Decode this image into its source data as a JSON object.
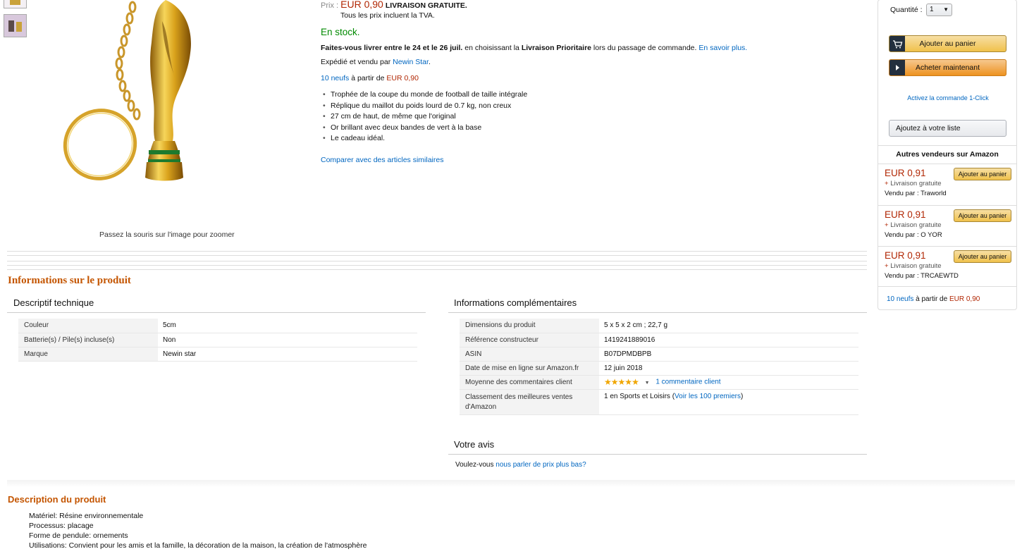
{
  "gallery": {
    "zoom_hint": "Passez la souris sur l'image pour zoomer"
  },
  "offer": {
    "price_label": "Prix :",
    "price": "EUR 0,90",
    "free_shipping": "LIVRAISON GRATUITE.",
    "tva_note": "Tous les prix incluent la TVA.",
    "availability": "En stock.",
    "delivery_prefix": "Faites-vous livrer entre le 24 et le 26 juil.",
    "delivery_mid": " en choisissant la ",
    "delivery_option": "Livraison Prioritaire",
    "delivery_suffix": " lors du passage de commande. ",
    "learn_more": "En savoir plus.",
    "shipped_prefix": "Expédié et vendu par ",
    "seller": "Newin Star",
    "new_count_link": "10 neufs",
    "new_from_text": " à partir de ",
    "new_from_price": "EUR 0,90",
    "bullets": [
      "Trophée de la coupe du monde de football de taille intégrale",
      "Réplique du maillot du poids lourd de 0.7 kg, non creux",
      "27 cm de haut, de même que l'original",
      "Or brillant avec deux bandes de vert à la base",
      "Le cadeau idéal."
    ],
    "compare_link": "Comparer avec des articles similaires"
  },
  "buybox": {
    "quantity_label": "Quantité :",
    "quantity_value": "1",
    "add_to_cart": "Ajouter au panier",
    "buy_now": "Acheter maintenant",
    "one_click": "Activez la commande 1-Click",
    "add_to_list": "Ajoutez à votre liste",
    "other_sellers_title": "Autres vendeurs sur Amazon",
    "other_offers": [
      {
        "price": "EUR 0,91",
        "shipping": "Livraison gratuite",
        "seller_prefix": "Vendu par : ",
        "seller": "Traworld",
        "button": "Ajouter au panier"
      },
      {
        "price": "EUR 0,91",
        "shipping": "Livraison gratuite",
        "seller_prefix": "Vendu par : ",
        "seller": "O YOR",
        "button": "Ajouter au panier"
      },
      {
        "price": "EUR 0,91",
        "shipping": "Livraison gratuite",
        "seller_prefix": "Vendu par : ",
        "seller": "TRCAEWTD",
        "button": "Ajouter au panier"
      }
    ],
    "new_count_link": "10 neufs",
    "new_from_text": " à partir de ",
    "new_from_price": "EUR 0,90"
  },
  "product_info": {
    "title": "Informations sur le produit",
    "tech_title": "Descriptif technique",
    "tech_rows": [
      {
        "key": "Couleur",
        "value": "5cm"
      },
      {
        "key": "Batterie(s) / Pile(s) incluse(s)",
        "value": "Non"
      },
      {
        "key": "Marque",
        "value": "Newin star"
      }
    ],
    "extra_title": "Informations complémentaires",
    "extra_rows": {
      "dimensions_key": "Dimensions du produit",
      "dimensions_value": "5 x 5 x 2 cm ; 22,7 g",
      "ref_key": "Référence constructeur",
      "ref_value": "1419241889016",
      "asin_key": "ASIN",
      "asin_value": "B07DPMDBPB",
      "date_key": "Date de mise en ligne sur Amazon.fr",
      "date_value": "12 juin 2018",
      "rating_key": "Moyenne des commentaires client",
      "rating_stars": 5,
      "rating_link": "1 commentaire client",
      "rank_key": "Classement des meilleures ventes d'Amazon",
      "rank_text": "1 en Sports et Loisirs (",
      "rank_link": "Voir les 100 premiers",
      "rank_close": ")"
    },
    "feedback_title": "Votre avis",
    "feedback_prefix": "Voulez-vous ",
    "feedback_link": "nous parler de prix plus bas?"
  },
  "description": {
    "title": "Description du produit",
    "lines": [
      "Matériel: Résine environnementale",
      "Processus: placage",
      "Forme de pendule: ornements",
      "Utilisations: Convient pour les amis et la famille, la décoration de la maison, la création de l'atmosphère"
    ]
  },
  "colors": {
    "price": "#b12704",
    "link": "#0066c0",
    "stock": "#008a00",
    "section_title": "#c45500",
    "button_yellow": "#f0c14b",
    "button_orange": "#ed9220"
  },
  "icons": [
    "cart-icon",
    "play-icon",
    "star-icon",
    "chevron-down-icon"
  ]
}
